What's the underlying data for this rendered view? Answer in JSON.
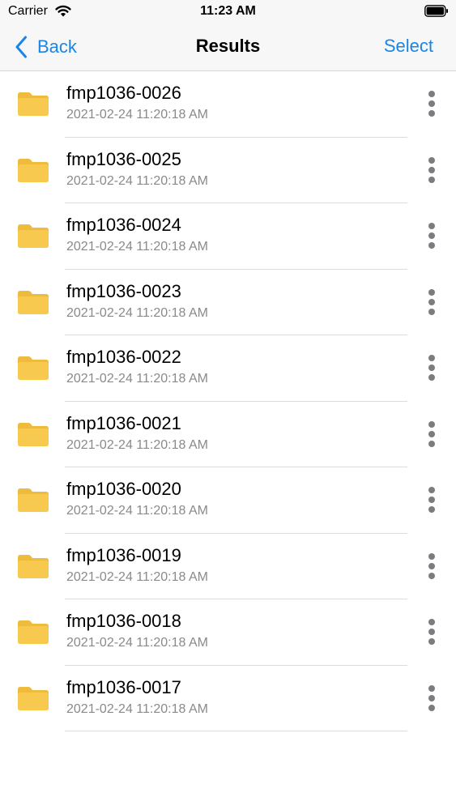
{
  "status_bar": {
    "carrier": "Carrier",
    "time": "11:23 AM"
  },
  "nav": {
    "back_label": "Back",
    "title": "Results",
    "select_label": "Select"
  },
  "colors": {
    "accent": "#1a85e6",
    "folder": "#f7c94f",
    "folder_tab": "#efbb3c",
    "secondary_text": "#8a8a8e"
  },
  "items": [
    {
      "name": "fmp1036-0026",
      "date": "2021-02-24 11:20:18 AM",
      "icon": "folder-icon"
    },
    {
      "name": "fmp1036-0025",
      "date": "2021-02-24 11:20:18 AM",
      "icon": "folder-icon"
    },
    {
      "name": "fmp1036-0024",
      "date": "2021-02-24 11:20:18 AM",
      "icon": "folder-icon"
    },
    {
      "name": "fmp1036-0023",
      "date": "2021-02-24 11:20:18 AM",
      "icon": "folder-icon"
    },
    {
      "name": "fmp1036-0022",
      "date": "2021-02-24 11:20:18 AM",
      "icon": "folder-icon"
    },
    {
      "name": "fmp1036-0021",
      "date": "2021-02-24 11:20:18 AM",
      "icon": "folder-icon"
    },
    {
      "name": "fmp1036-0020",
      "date": "2021-02-24 11:20:18 AM",
      "icon": "folder-icon"
    },
    {
      "name": "fmp1036-0019",
      "date": "2021-02-24 11:20:18 AM",
      "icon": "folder-icon"
    },
    {
      "name": "fmp1036-0018",
      "date": "2021-02-24 11:20:18 AM",
      "icon": "folder-icon"
    },
    {
      "name": "fmp1036-0017",
      "date": "2021-02-24 11:20:18 AM",
      "icon": "folder-icon"
    }
  ]
}
